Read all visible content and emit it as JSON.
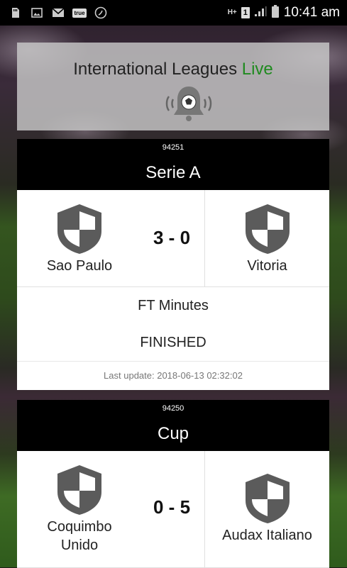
{
  "status_bar": {
    "time": "10:41 am",
    "network": "H+",
    "sim": "1",
    "notification_icons": [
      "sd-card-icon",
      "image-icon",
      "gmail-icon",
      "true-app-icon",
      "phone-app-icon"
    ],
    "true_label": "true"
  },
  "header": {
    "title_main": "International Leagues",
    "title_accent": "Live",
    "accent_color": "#1f8a1f"
  },
  "matches": [
    {
      "id": "94251",
      "league": "Serie A",
      "home": "Sao Paulo",
      "away": "Vitoria",
      "score": "3 - 0",
      "minutes": "FT Minutes",
      "status": "FINISHED",
      "last_update": "Last update: 2018-06-13 02:32:02"
    },
    {
      "id": "94250",
      "league": "Cup",
      "home": "Coquimbo Unido",
      "away": "Audax Italiano",
      "score": "0 - 5"
    }
  ]
}
